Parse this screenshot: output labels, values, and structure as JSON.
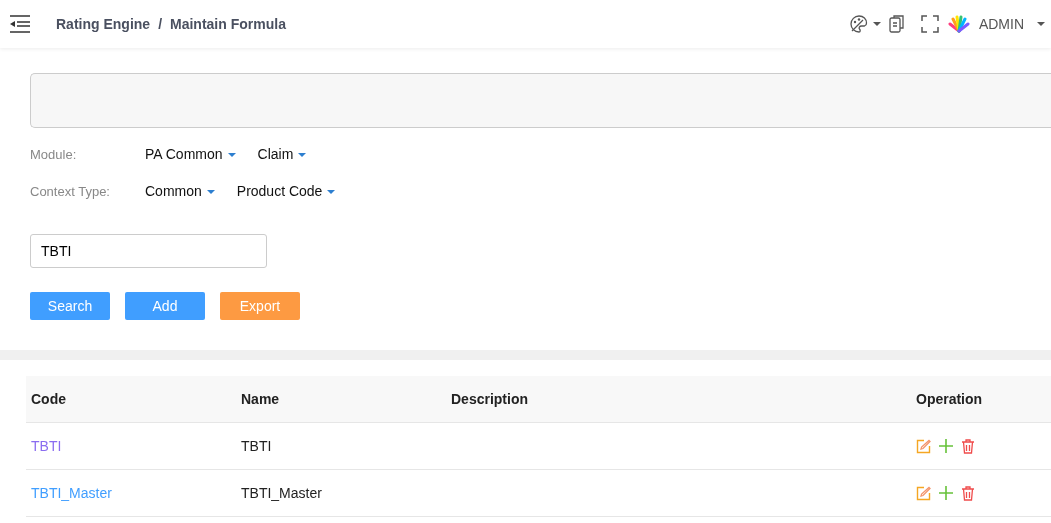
{
  "header": {
    "breadcrumb": [
      "Rating Engine",
      "Maintain Formula"
    ],
    "separator": "/",
    "user": "ADMIN"
  },
  "filters": [
    {
      "label": "Module:",
      "options": [
        "PA Common",
        "Claim"
      ]
    },
    {
      "label": "Context Type:",
      "options": [
        "Common",
        "Product Code"
      ]
    }
  ],
  "search": {
    "value": "TBTI"
  },
  "buttons": [
    {
      "label": "Search",
      "kind": "primary"
    },
    {
      "label": "Add",
      "kind": "primary"
    },
    {
      "label": "Export",
      "kind": "warning"
    }
  ],
  "table": {
    "columns": [
      "Code",
      "Name",
      "Description",
      "Operation"
    ],
    "rows": [
      {
        "code": "TBTI",
        "visited": true,
        "name": "TBTI"
      },
      {
        "code": "TBTI_Master",
        "visited": false,
        "name": "TBTI_Master"
      }
    ]
  }
}
